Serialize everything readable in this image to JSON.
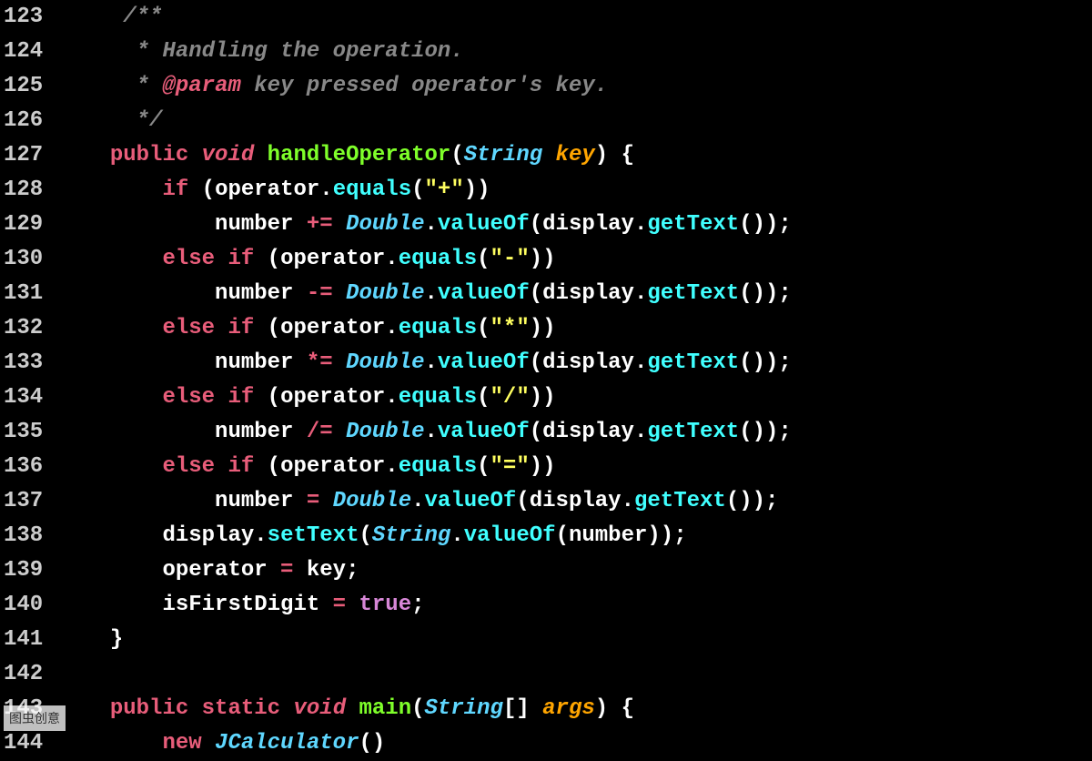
{
  "line_numbers": [
    "123",
    "124",
    "125",
    "126",
    "127",
    "128",
    "129",
    "130",
    "131",
    "132",
    "133",
    "134",
    "135",
    "136",
    "137",
    "138",
    "139",
    "140",
    "141",
    "142",
    "143",
    "144"
  ],
  "watermark": "图虫创意",
  "code": {
    "l123": {
      "comment_open": "/**"
    },
    "l124": {
      "star": " * ",
      "text": "Handling the operation."
    },
    "l125": {
      "star": " * ",
      "tag": "@param",
      "rest": " key pressed operator's key."
    },
    "l126": {
      "comment_close": " */"
    },
    "l127": {
      "kw_public": "public",
      "kw_void": "void",
      "method": "handleOperator",
      "lp": "(",
      "type": "String",
      "arg": "key",
      "rp": ")",
      "brace": " {"
    },
    "l128": {
      "kw_if": "if",
      "lp": " (",
      "ident": "operator",
      "dot": ".",
      "call": "equals",
      "lp2": "(",
      "str": "\"+\"",
      "rp2": "))"
    },
    "l129": {
      "ident": "number",
      "op": " += ",
      "type": "Double",
      "dot": ".",
      "call": "valueOf",
      "lp": "(",
      "ident2": "display",
      "dot2": ".",
      "call2": "getText",
      "rp": "());"
    },
    "l130": {
      "kw_else": "else",
      "kw_if": "if",
      "lp": " (",
      "ident": "operator",
      "dot": ".",
      "call": "equals",
      "lp2": "(",
      "str": "\"-\"",
      "rp2": "))"
    },
    "l131": {
      "ident": "number",
      "op": " -= ",
      "type": "Double",
      "dot": ".",
      "call": "valueOf",
      "lp": "(",
      "ident2": "display",
      "dot2": ".",
      "call2": "getText",
      "rp": "());"
    },
    "l132": {
      "kw_else": "else",
      "kw_if": "if",
      "lp": " (",
      "ident": "operator",
      "dot": ".",
      "call": "equals",
      "lp2": "(",
      "str": "\"*\"",
      "rp2": "))"
    },
    "l133": {
      "ident": "number",
      "op": " *= ",
      "type": "Double",
      "dot": ".",
      "call": "valueOf",
      "lp": "(",
      "ident2": "display",
      "dot2": ".",
      "call2": "getText",
      "rp": "());"
    },
    "l134": {
      "kw_else": "else",
      "kw_if": "if",
      "lp": " (",
      "ident": "operator",
      "dot": ".",
      "call": "equals",
      "lp2": "(",
      "str": "\"/\"",
      "rp2": "))"
    },
    "l135": {
      "ident": "number",
      "op": " /= ",
      "type": "Double",
      "dot": ".",
      "call": "valueOf",
      "lp": "(",
      "ident2": "display",
      "dot2": ".",
      "call2": "getText",
      "rp": "());"
    },
    "l136": {
      "kw_else": "else",
      "kw_if": "if",
      "lp": " (",
      "ident": "operator",
      "dot": ".",
      "call": "equals",
      "lp2": "(",
      "str": "\"=\"",
      "rp2": "))"
    },
    "l137": {
      "ident": "number",
      "op": " = ",
      "type": "Double",
      "dot": ".",
      "call": "valueOf",
      "lp": "(",
      "ident2": "display",
      "dot2": ".",
      "call2": "getText",
      "rp": "());"
    },
    "l138": {
      "ident": "display",
      "dot": ".",
      "call": "setText",
      "lp": "(",
      "type": "String",
      "dot2": ".",
      "call2": "valueOf",
      "lp2": "(",
      "ident2": "number",
      "rp": "));"
    },
    "l139": {
      "ident": "operator",
      "op": " = ",
      "ident2": "key",
      "semi": ";"
    },
    "l140": {
      "ident": "isFirstDigit",
      "op": " = ",
      "bool": "true",
      "semi": ";"
    },
    "l141": {
      "brace": "}"
    },
    "l142": {
      "blank": ""
    },
    "l143": {
      "kw_public": "public",
      "kw_static": "static",
      "kw_void": "void",
      "method": "main",
      "lp": "(",
      "type": "String",
      "arr": "[]",
      "arg": "args",
      "rp": ")",
      "brace": " {"
    },
    "l144": {
      "kw_new": "new",
      "cls": "JCalculator",
      "call": "()"
    }
  }
}
